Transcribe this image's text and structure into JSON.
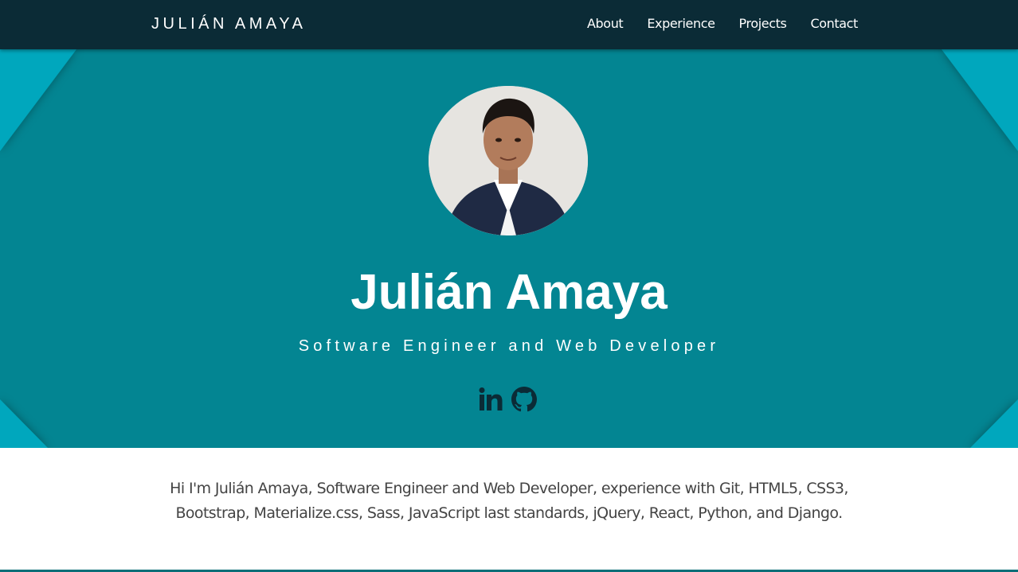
{
  "nav": {
    "brand": "JULIÁN AMAYA",
    "links": [
      "About",
      "Experience",
      "Projects",
      "Contact"
    ]
  },
  "hero": {
    "name": "Julián Amaya",
    "subtitle": "Software Engineer and Web Developer",
    "socials": [
      "linkedin-icon",
      "github-icon"
    ]
  },
  "about": {
    "line1": "Hi I'm Julián Amaya, Software Engineer and Web Developer, experience with Git, HTML5, CSS3,",
    "line2": "Bootstrap, Materialize.css, Sass, JavaScript last standards, jQuery, React, Python, and Django."
  },
  "colors": {
    "navbar": "#0b2b36",
    "hero": "#038592",
    "hero_corner": "#00a7bd",
    "icon": "#0b2b36",
    "text": "#444444"
  }
}
